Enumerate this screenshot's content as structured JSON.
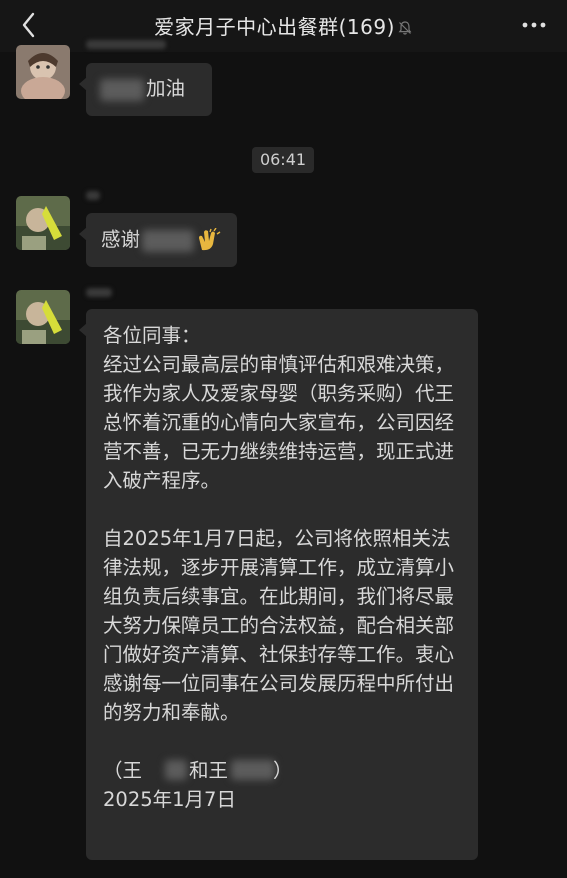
{
  "header": {
    "title": "爱家月子中心出餐群(169)"
  },
  "messages": [
    {
      "text": "加油"
    },
    {
      "time": "06:41"
    },
    {
      "text": "感谢"
    },
    {
      "greeting": "各位同事：",
      "para1": "经过公司最高层的审慎评估和艰难决策，我作为家人及爱家母婴（职务采购）代王总怀着沉重的心情向大家宣布，公司因经营不善，已无力继续维持运营，现正式进入破产程序。",
      "para2": "自2025年1月7日起，公司将依照相关法律法规，逐步开展清算工作，成立清算小组负责后续事宜。在此期间，我们将尽最大努力保障员工的合法权益，配合相关部门做好资产清算、社保封存等工作。衷心感谢每一位同事在公司发展历程中所付出的努力和奉献。",
      "sign_open": "（王",
      "sign_mid": "和王",
      "sign_close": "）",
      "date": "2025年1月7日"
    }
  ],
  "colors": {
    "background": "#111111",
    "bubble": "#2c2c2c",
    "text": "#d8d8d8"
  },
  "icons": [
    "back-arrow-icon",
    "mute-bell-icon",
    "more-dots-icon",
    "clap-hands-emoji"
  ]
}
